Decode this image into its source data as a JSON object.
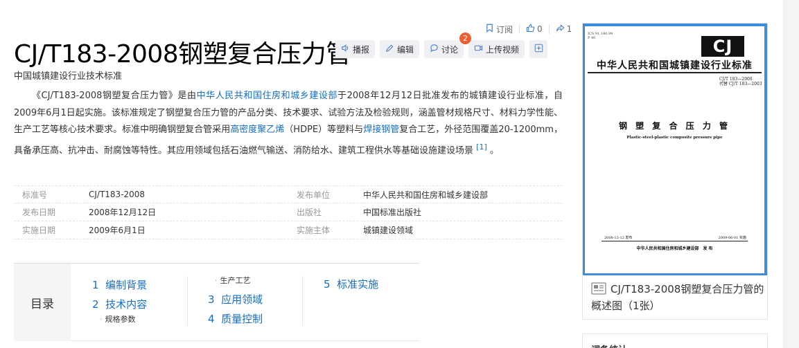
{
  "actions": {
    "subscribe_label": "订阅",
    "like_count": "0",
    "share_count": "1"
  },
  "title": "CJ/T183-2008钢塑复合压力管",
  "toolbar": {
    "broadcast": "播报",
    "edit": "编辑",
    "discuss": "讨论",
    "discuss_badge": "2",
    "upload_video": "上传视频"
  },
  "subtitle": "中国城镇建设行业技术标准",
  "summary": {
    "p1": "《CJ/T183-2008钢塑复合压力管》是由",
    "link1": "中华人民共和国住房和城乡建设部",
    "p2": "于2008年12月12日批准发布的城镇建设行业标准，自2009年6月1日起实施。该标准规定了钢塑复合压力管的产品分类、技术要求、试验方法及检验规则，涵盖管材规格尺寸、材料力学性能、生产工艺等核心技术要求。标准中明确钢塑复合管采用",
    "link2": "高密度聚乙烯",
    "p3": "（HDPE）等塑料与",
    "link3": "焊接钢管",
    "p4": "复合工艺，外径范围覆盖20-1200mm，具备承压高、抗冲击、耐腐蚀等特性。其应用领域包括石油燃气输送、消防给水、建筑工程供水等基础设施建设场景",
    "ref": "[1]",
    "end": "。"
  },
  "info": [
    {
      "l1": "标准号",
      "v1": "CJ/T183-2008",
      "l2": "发布单位",
      "v2": "中华人民共和国住房和城乡建设部"
    },
    {
      "l1": "发布日期",
      "v1": "2008年12月12日",
      "l2": "出版社",
      "v2": "中国标准出版社"
    },
    {
      "l1": "实施日期",
      "v1": "2009年6月1日",
      "l2": "实施主体",
      "v2": "城镇建设领域"
    }
  ],
  "toc": {
    "label": "目录",
    "items": [
      {
        "num": "1",
        "text": "编制背景"
      },
      {
        "num": "2",
        "text": "技术内容"
      },
      {
        "num": "3",
        "text": "应用领域"
      },
      {
        "num": "4",
        "text": "质量控制"
      },
      {
        "num": "5",
        "text": "标准实施"
      }
    ],
    "subs": [
      "规格参数",
      "生产工艺"
    ]
  },
  "cover": {
    "ics": "ICS 91.140.99\nP 40",
    "logo": "CJ",
    "org": "中华人民共和国城镇建设行业标准",
    "code": "CJ/T 183—2008\n代替 CJ/T 183—2003",
    "name": "钢 塑 复 合 压 力 管",
    "eng": "Plastic-steel-plastic composite pressure pipe",
    "issue_date": "2008-12-12 发布",
    "impl_date": "2009-06-01 实施",
    "publisher": "中华人民共和国住房和城乡建设部　发 布",
    "caption": "CJ/T183-2008钢塑复合压力管的概述图（1张）"
  },
  "next_card": "词条统计"
}
